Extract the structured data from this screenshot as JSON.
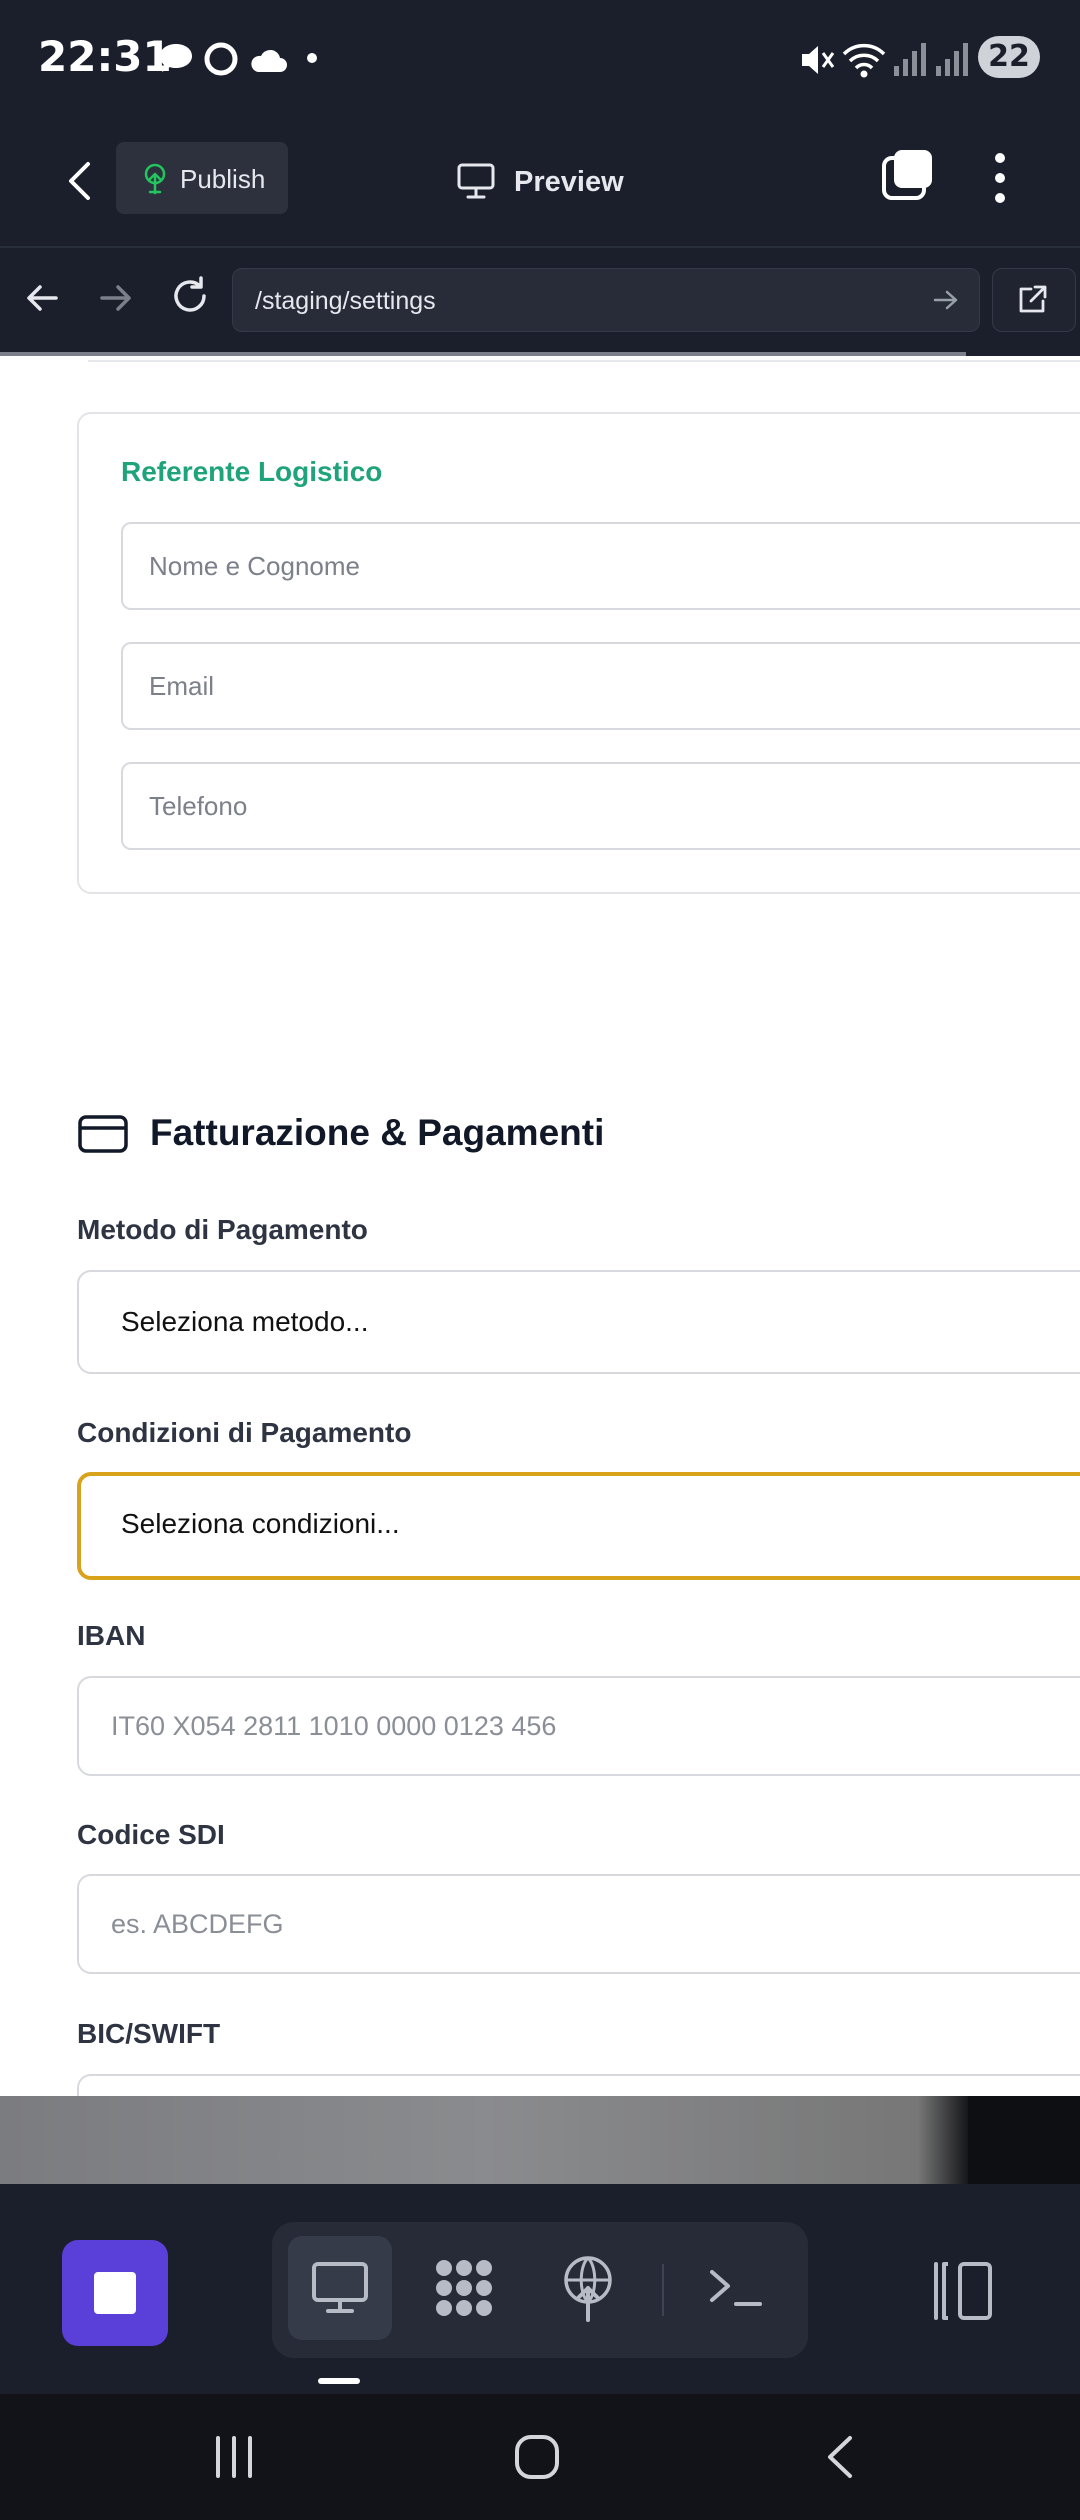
{
  "status_bar": {
    "time": "22:31",
    "battery": "22",
    "icons": [
      "chat-bubble-icon",
      "circle-icon",
      "cloud-icon",
      "dot-icon",
      "mute-icon",
      "wifi-icon",
      "signal-icon",
      "signal-icon"
    ]
  },
  "app_bar": {
    "publish_label": "Publish",
    "preview_label": "Preview"
  },
  "browser": {
    "url": "/staging/settings"
  },
  "logistics_card": {
    "title": "Referente Logistico",
    "fields": [
      {
        "placeholder": "Nome e Cognome"
      },
      {
        "placeholder": "Email"
      },
      {
        "placeholder": "Telefono"
      }
    ]
  },
  "billing_section": {
    "title": "Fatturazione & Pagamenti",
    "payment_method_label": "Metodo di Pagamento",
    "payment_method_value": "Seleziona metodo...",
    "payment_terms_label": "Condizioni di Pagamento",
    "payment_terms_value": "Seleziona condizioni...",
    "iban_label": "IBAN",
    "iban_placeholder": "IT60 X054 2811 1010 0000 0123 456",
    "sdi_label": "Codice SDI",
    "sdi_placeholder": "es. ABCDEFG",
    "bic_label": "BIC/SWIFT"
  },
  "colors": {
    "accent_green": "#1fa37a",
    "active_border": "#d9a21b",
    "stop_button": "#5b3fd9",
    "dark_bg": "#1b1f2b"
  }
}
